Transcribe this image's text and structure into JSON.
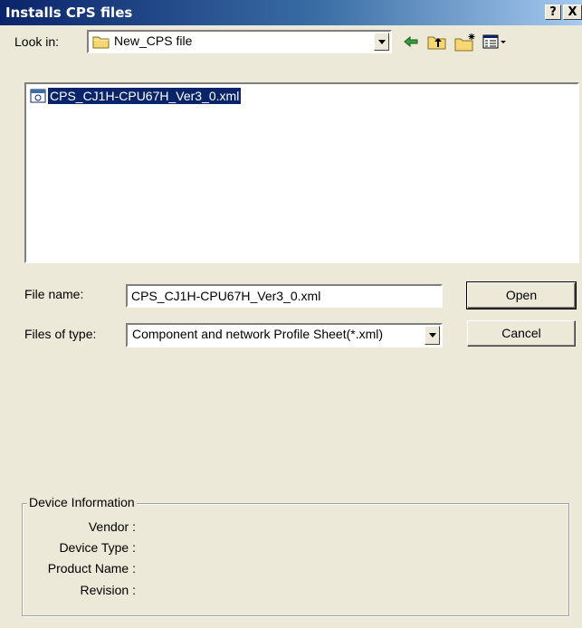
{
  "window": {
    "title": "Installs CPS files",
    "help_label": "?",
    "close_label": "X"
  },
  "look_in": {
    "label": "Look in:",
    "value": "New_CPS file"
  },
  "toolbar": {
    "icons": [
      "back-arrow-icon",
      "up-folder-icon",
      "new-folder-icon",
      "view-menu-icon"
    ]
  },
  "file_list": {
    "items": [
      {
        "name": "CPS_CJ1H-CPU67H_Ver3_0.xml",
        "selected": true
      }
    ]
  },
  "file_name": {
    "label": "File name:",
    "value": "CPS_CJ1H-CPU67H_Ver3_0.xml"
  },
  "file_type": {
    "label": "Files of type:",
    "value": "Component and network Profile Sheet(*.xml)"
  },
  "buttons": {
    "open": "Open",
    "cancel": "Cancel"
  },
  "device_info": {
    "title": "Device Information",
    "vendor_label": "Vendor :",
    "device_type_label": "Device Type :",
    "product_name_label": "Product Name :",
    "revision_label": "Revision :"
  },
  "colors": {
    "titlebar_start": "#0a246a",
    "titlebar_end": "#a6caf0",
    "selection": "#0a246a",
    "dialog_bg": "#ece9d8"
  }
}
